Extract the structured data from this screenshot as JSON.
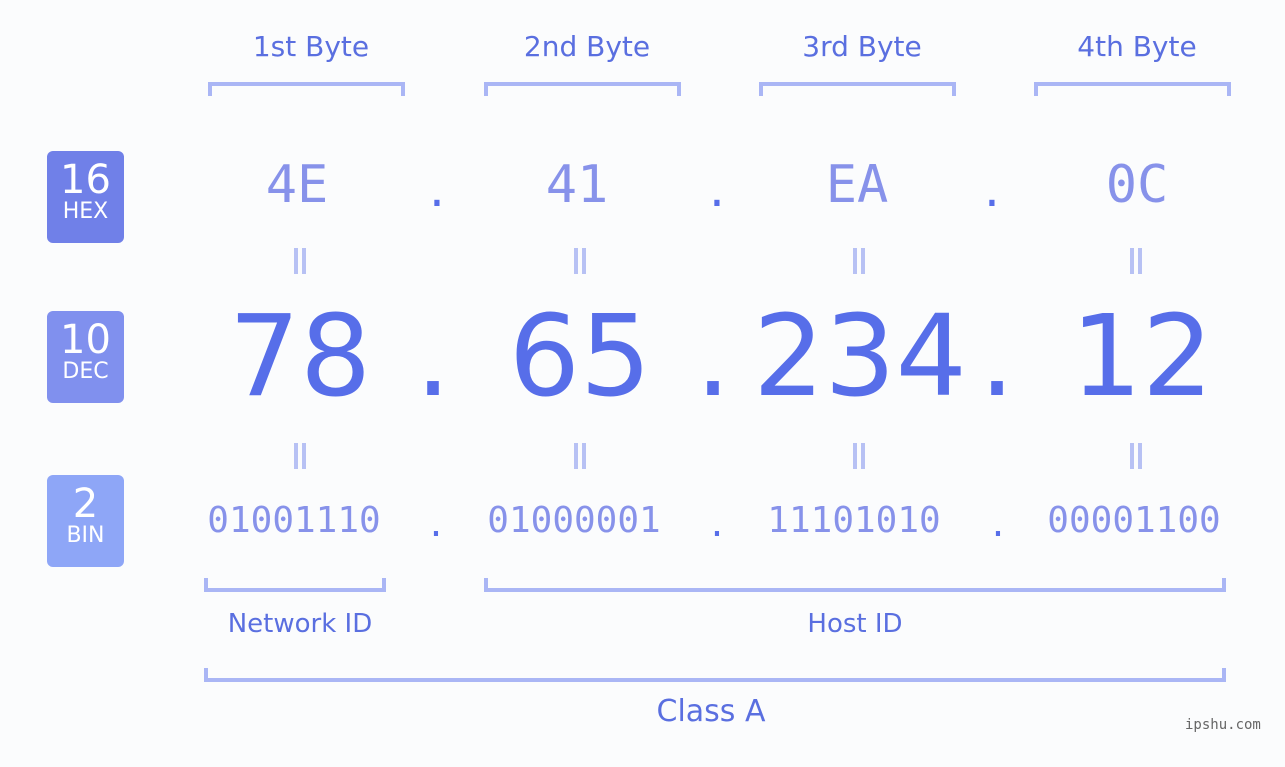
{
  "badges": [
    {
      "number": "16",
      "label": "HEX",
      "color": "#7080e8"
    },
    {
      "number": "10",
      "label": "DEC",
      "color": "#8090ee"
    },
    {
      "number": "2",
      "label": "BIN",
      "color": "#8ea6f7"
    }
  ],
  "bytes": [
    {
      "label": "1st Byte",
      "hex": "4E",
      "dec": "78",
      "bin": "01001110"
    },
    {
      "label": "2nd Byte",
      "hex": "41",
      "dec": "65",
      "bin": "01000001"
    },
    {
      "label": "3rd Byte",
      "hex": "EA",
      "dec": "234",
      "bin": "11101010"
    },
    {
      "label": "4th Byte",
      "hex": "0C",
      "dec": "12",
      "bin": "00001100"
    }
  ],
  "separator": ".",
  "groups": {
    "network": "Network ID",
    "host": "Host ID",
    "class": "Class A"
  },
  "watermark": "ipshu.com",
  "colors": {
    "accent": "#576ee9",
    "light": "#aab6f5"
  }
}
